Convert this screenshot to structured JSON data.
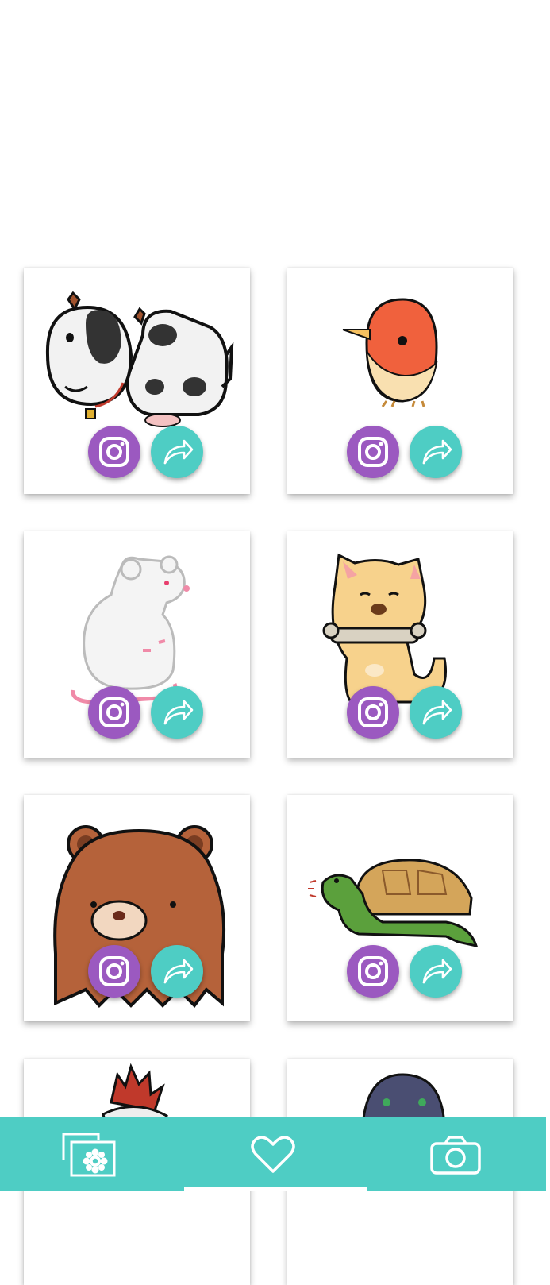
{
  "colors": {
    "instagram_button": "#9b59c0",
    "share_button": "#4ecdc4",
    "bottom_bar": "#4ecdc4",
    "card_background": "#ffffff"
  },
  "gallery": {
    "items": [
      {
        "subject": "cow",
        "instagram_icon": "instagram-icon",
        "share_icon": "share-arrow-icon"
      },
      {
        "subject": "bird",
        "instagram_icon": "instagram-icon",
        "share_icon": "share-arrow-icon"
      },
      {
        "subject": "rat",
        "instagram_icon": "instagram-icon",
        "share_icon": "share-arrow-icon"
      },
      {
        "subject": "dog",
        "instagram_icon": "instagram-icon",
        "share_icon": "share-arrow-icon"
      },
      {
        "subject": "bear",
        "instagram_icon": "instagram-icon",
        "share_icon": "share-arrow-icon"
      },
      {
        "subject": "turtle",
        "instagram_icon": "instagram-icon",
        "share_icon": "share-arrow-icon"
      },
      {
        "subject": "rooster",
        "instagram_icon": "",
        "share_icon": ""
      },
      {
        "subject": "penguin",
        "instagram_icon": "",
        "share_icon": ""
      }
    ]
  },
  "bottom_nav": {
    "items": [
      {
        "icon": "gallery-settings-icon",
        "active": false
      },
      {
        "icon": "heart-icon",
        "active": true
      },
      {
        "icon": "camera-icon",
        "active": false
      }
    ]
  }
}
